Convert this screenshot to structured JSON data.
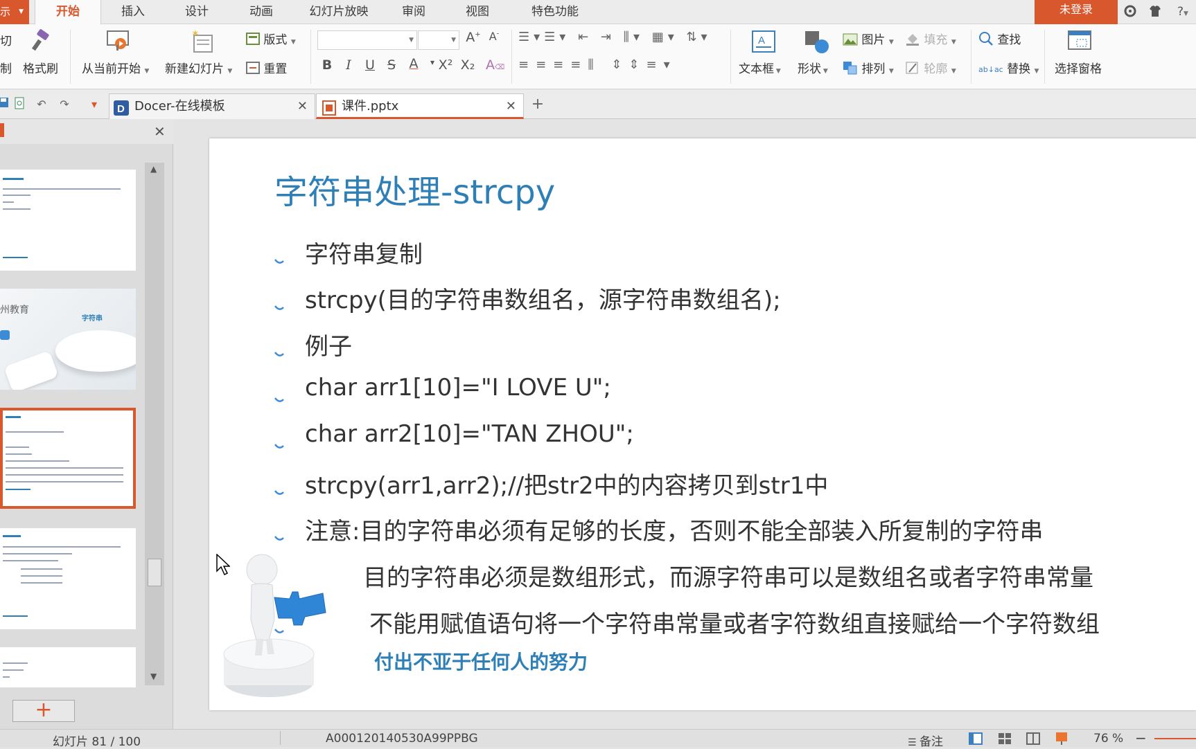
{
  "menubar": {
    "app_label": "示",
    "tabs": [
      "开始",
      "插入",
      "设计",
      "动画",
      "幻灯片放映",
      "审阅",
      "视图",
      "特色功能"
    ],
    "login": "未登录",
    "help": "?"
  },
  "ribbon": {
    "cut": "切",
    "copy": "制",
    "format_painter": "格式刷",
    "from_current": "从当前开始",
    "new_slide": "新建幻灯片",
    "layout": "版式",
    "reset": "重置",
    "bold": "B",
    "italic": "I",
    "underline": "U",
    "strike": "S",
    "font_color": "A",
    "superscript": "X²",
    "subscript": "X₂",
    "textbox": "文本框",
    "shape": "形状",
    "picture": "图片",
    "arrange": "排列",
    "fill": "填充",
    "outline": "轮廓",
    "find": "查找",
    "replace": "替换",
    "selection_pane": "选择窗格"
  },
  "tabs": {
    "docer": "Docer-在线模板",
    "file": "课件.pptx"
  },
  "slide": {
    "title": "字符串处理-strcpy",
    "bullets": [
      "字符串复制",
      "strcpy(目的字符串数组名，源字符串数组名);",
      "例子",
      " char arr1[10]=\"I LOVE U\";",
      " char arr2[10]=\"TAN ZHOU\";",
      "strcpy(arr1,arr2);//把str2中的内容拷贝到str1中",
      "注意:目的字符串必须有足够的长度，否则不能全部装入所复制的字符串",
      "目的字符串必须是数组形式，而源字符串可以是数组名或者字符串常量",
      "不能用赋值语句将一个字符串常量或者字符数组直接赋给一个字符数组"
    ],
    "slogan": "付出不亚于任何人的努力"
  },
  "thumbs": {
    "t2_text": "州教育",
    "t2_badge": "字符串"
  },
  "statusbar": {
    "slide_count": "幻灯片 81 / 100",
    "doc_id": "A000120140530A99PPBG",
    "notes": "备注",
    "zoom": "76 %"
  },
  "colors": {
    "accent": "#d9572c",
    "title_blue": "#2e7fb6"
  }
}
